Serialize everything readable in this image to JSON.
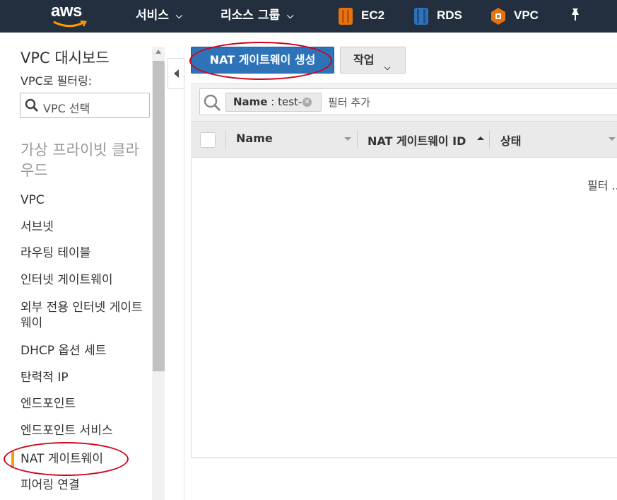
{
  "topbar": {
    "logo_text": "aws",
    "services_label": "서비스",
    "resource_groups_label": "리소스 그룹",
    "shortcuts": [
      {
        "label": "EC2",
        "icon": "ec2-icon",
        "color": "#e8720c"
      },
      {
        "label": "RDS",
        "icon": "rds-icon",
        "color": "#2e73b8"
      },
      {
        "label": "VPC",
        "icon": "vpc-icon",
        "color": "#e8720c"
      }
    ],
    "pin_icon": "pin-icon"
  },
  "sidebar": {
    "title": "VPC 대시보드",
    "filter_label": "VPC로 필터링:",
    "filter_placeholder": "VPC 선택",
    "section_label": "가상 프라이빗 클라우드",
    "items": [
      {
        "label": "VPC"
      },
      {
        "label": "서브넷"
      },
      {
        "label": "라우팅 테이블"
      },
      {
        "label": "인터넷 게이트웨이"
      },
      {
        "label": "외부 전용 인터넷 게이트웨이"
      },
      {
        "label": "DHCP 옵션 세트"
      },
      {
        "label": "탄력적 IP"
      },
      {
        "label": "엔드포인트"
      },
      {
        "label": "엔드포인트 서비스"
      },
      {
        "label": "NAT 게이트웨이",
        "active": true
      },
      {
        "label": "피어링 연결"
      }
    ]
  },
  "main": {
    "create_button": "NAT 게이트웨이 생성",
    "actions_button": "작업",
    "filter": {
      "chip_key": "Name",
      "chip_sep": " : ",
      "chip_value": "test-",
      "add_filter": "필터 추가"
    },
    "columns": [
      {
        "label": "Name"
      },
      {
        "label": "NAT 게이트웨이 ID"
      },
      {
        "label": "상태"
      }
    ],
    "empty_text": "필터 ..."
  },
  "colors": {
    "topbar_bg": "#232f3e",
    "primary_button": "#2e73b8",
    "active_indicator": "#f79c0f",
    "annotation": "#d0021b"
  }
}
